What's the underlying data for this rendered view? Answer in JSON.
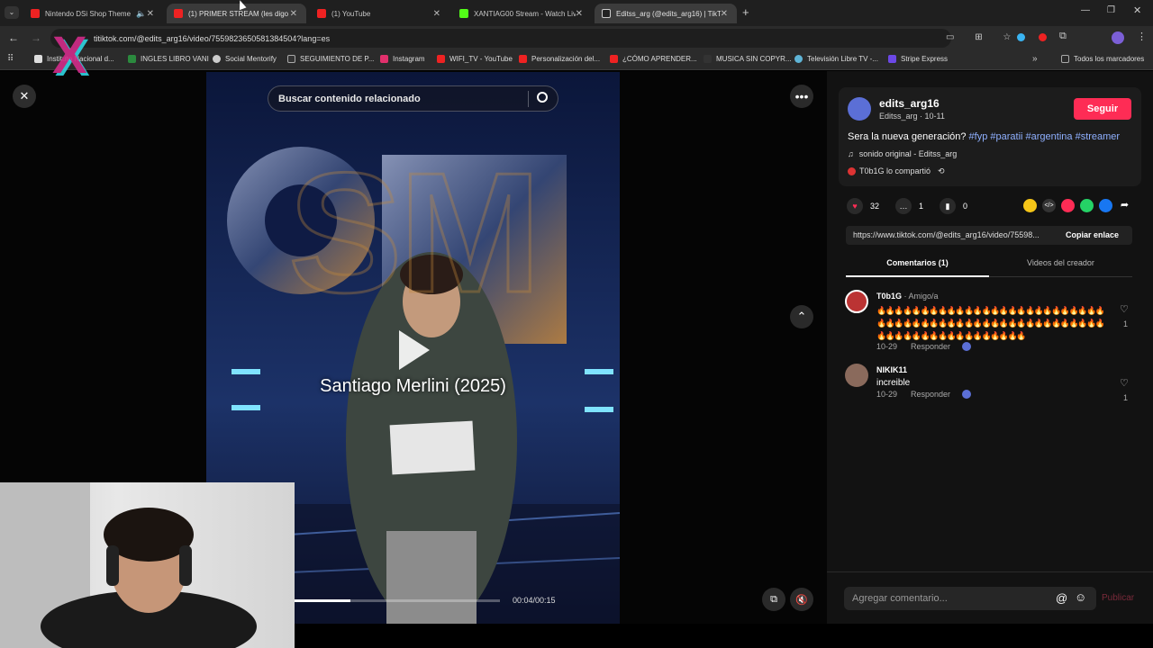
{
  "tabs": [
    {
      "label": "Nintendo DSi Shop Theme",
      "color": "#e22"
    },
    {
      "label": "(1) PRIMER STREAM (les digo q",
      "color": "#e22"
    },
    {
      "label": "(1) YouTube",
      "color": "#e22"
    },
    {
      "label": "XANTIAG00 Stream - Watch Liv",
      "color": "#53fc18"
    },
    {
      "label": "Editss_arg (@edits_arg16) | TikT",
      "color": "#111"
    }
  ],
  "url": "tiktok.com/@edits_arg16/video/7559823650581384504?lang=es",
  "url_prefix": "ti",
  "bookmarks": [
    "Instituto Nacional d...",
    "INGLES LIBRO VANI",
    "Social Mentorify",
    "SEGUIMIENTO DE P...",
    "Instagram",
    "WIFI_TV - YouTube",
    "Personalización del...",
    "¿CÓMO APRENDER...",
    "MUSICA SIN COPYR...",
    "Televisión Libre TV -...",
    "Stripe Express",
    "Todos los marcadores"
  ],
  "search": {
    "placeholder": "Buscar contenido relacionado"
  },
  "video": {
    "caption": "Santiago Merlini (2025)",
    "time": "00:04/00:15",
    "logo": "SM"
  },
  "author": {
    "name": "edits_arg16",
    "sub": "Editss_arg · 10-11",
    "follow": "Seguir"
  },
  "description": {
    "text": "Sera la nueva generación?",
    "tags": "#fyp #paratii #argentina #streamer"
  },
  "sound": "sonido original - Editss_arg",
  "shared": "T0b1G lo compartió",
  "stats": {
    "likes": "32",
    "comments": "1",
    "saves": "0"
  },
  "link": {
    "url": "https://www.tiktok.com/@edits_arg16/video/75598...",
    "copy": "Copiar enlace"
  },
  "side_tabs": [
    "Comentarios (1)",
    "Videos del creador"
  ],
  "comments": [
    {
      "user": "T0b1G",
      "badge": " · Amigo/a",
      "text": "🔥🔥🔥🔥🔥🔥🔥🔥🔥🔥🔥🔥🔥🔥🔥🔥🔥🔥🔥🔥🔥🔥🔥🔥🔥🔥🔥🔥🔥🔥🔥🔥🔥🔥🔥🔥🔥🔥🔥🔥🔥🔥🔥🔥🔥🔥🔥🔥🔥🔥🔥🔥🔥🔥🔥🔥🔥🔥🔥🔥🔥🔥🔥🔥🔥🔥🔥🔥🔥",
      "date": "10-29",
      "reply": "Responder",
      "likes": "1"
    },
    {
      "user": "NIKIK11",
      "badge": "",
      "text": "increible",
      "date": "10-29",
      "reply": "Responder",
      "likes": "1"
    }
  ],
  "compose": {
    "placeholder": "Agregar comentario...",
    "post": "Publicar"
  }
}
